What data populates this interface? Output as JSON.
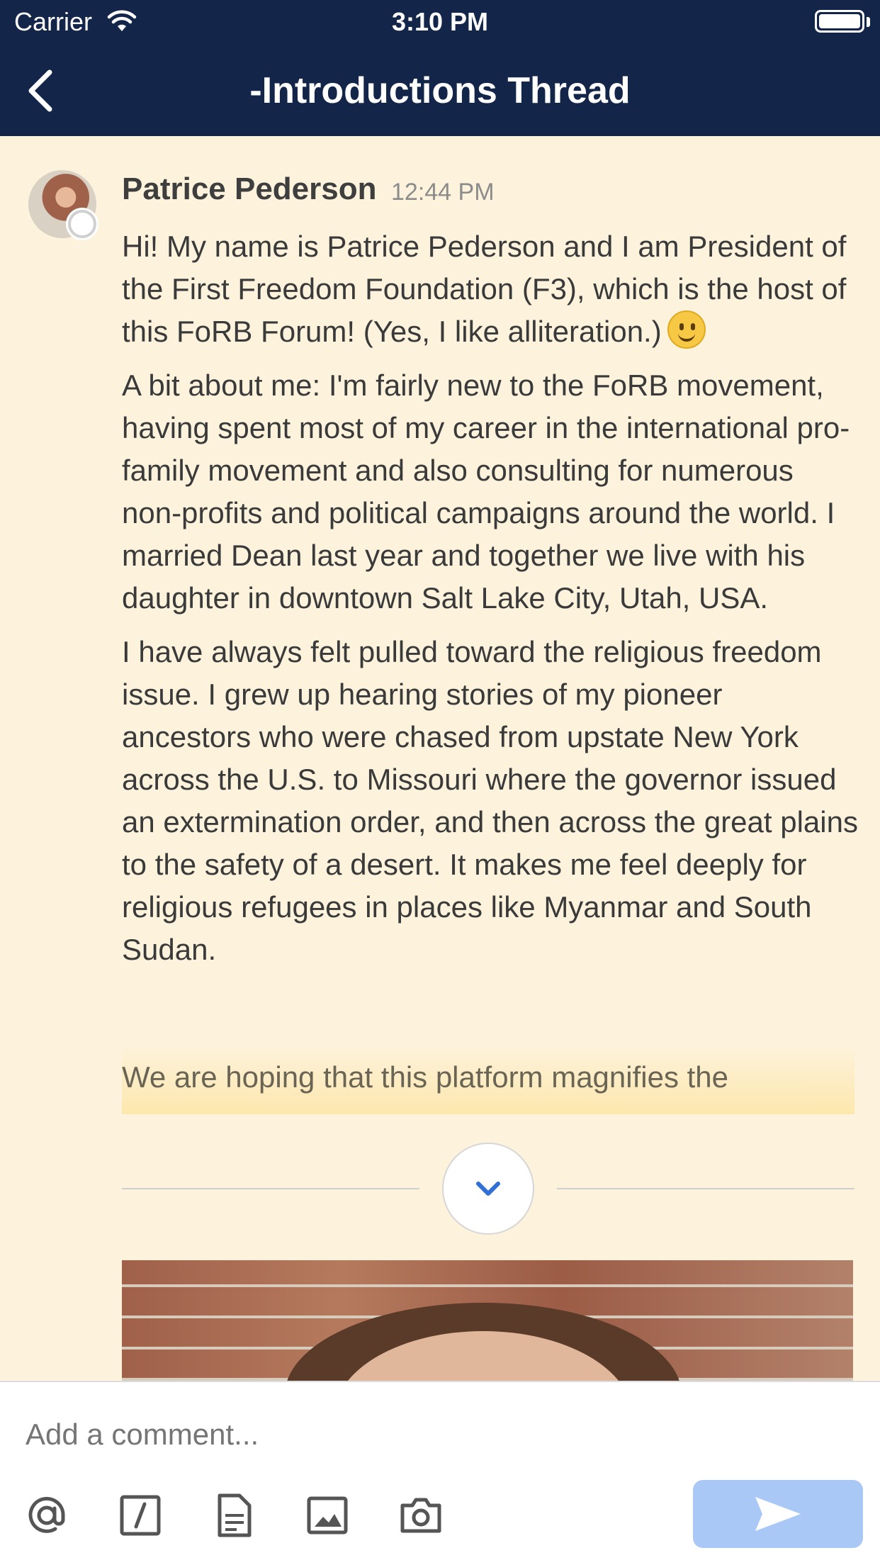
{
  "status_bar": {
    "carrier": "Carrier",
    "time": "3:10 PM"
  },
  "nav": {
    "title": "-Introductions Thread",
    "back_icon": "chevron-left-icon"
  },
  "post": {
    "author": "Patrice Pederson",
    "time": "12:44 PM",
    "paragraphs": [
      "Hi! My name is Patrice Pederson and I am President of the First Freedom Foundation (F3), which is the host of this FoRB Forum! (Yes, I like alliteration.)",
      "A bit about me: I'm fairly new to the FoRB movement, having spent most of my career in the international pro-family movement and also consulting for numerous non-profits and political campaigns around the world. I married Dean last year and together we live with his daughter in downtown Salt Lake City, Utah, USA.",
      "I have always felt pulled toward the religious freedom issue. I grew up hearing stories of my pioneer ancestors who were chased from upstate New York across the U.S. to Missouri where the governor issued an extermination order, and then across the great plains to the safety of a desert. It makes me feel deeply for religious refugees in places like Myanmar and South Sudan."
    ],
    "truncated_line": "We are hoping that this platform magnifies the",
    "emoji": "slightly-smiling-face-icon"
  },
  "comment": {
    "placeholder": "Add a comment...",
    "tools": [
      "at-mention-icon",
      "slash-command-icon",
      "file-icon",
      "image-icon",
      "camera-icon"
    ],
    "send_icon": "send-icon"
  },
  "colors": {
    "header": "#14254a",
    "background": "#fdf3dd",
    "send_button": "#a9c8f5",
    "expand_chevron": "#2f6fd6"
  }
}
